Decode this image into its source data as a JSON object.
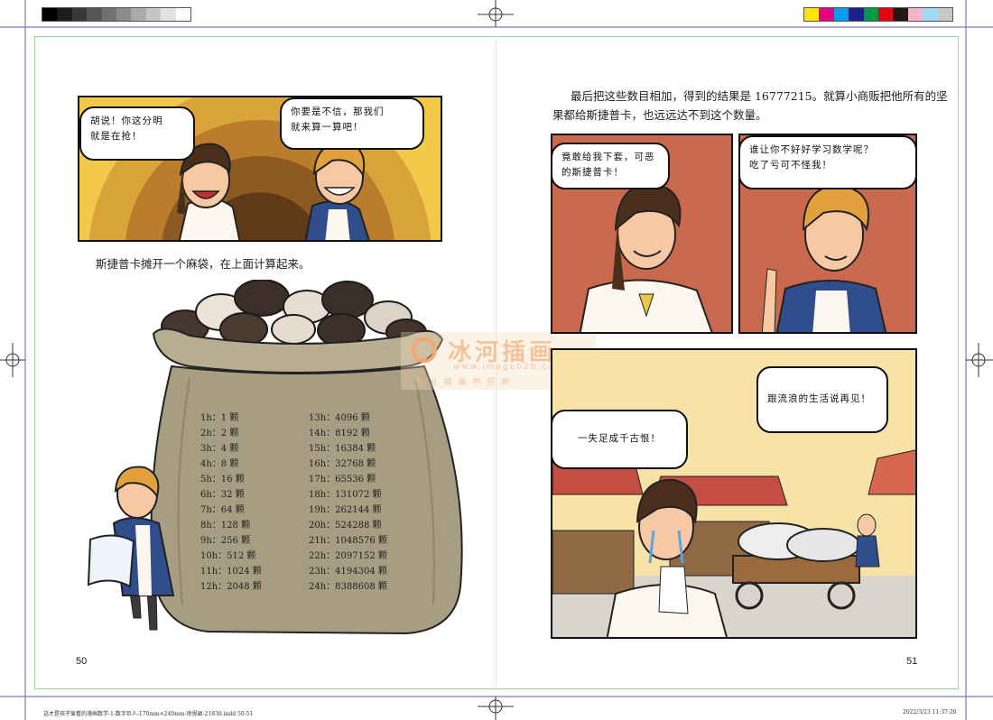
{
  "print_marks": {
    "grayscale_swatches": [
      "#000000",
      "#1c1c1c",
      "#383838",
      "#555555",
      "#717171",
      "#8d8d8d",
      "#aaaaaa",
      "#c6c6c6",
      "#e2e2e2",
      "#ffffff"
    ],
    "color_swatches": [
      "#ffe600",
      "#e4007f",
      "#00a0e9",
      "#1d2088",
      "#009944",
      "#e60012",
      "#231815",
      "#f5b2c8",
      "#9fd9f6",
      "#c9c9c9"
    ]
  },
  "left_page": {
    "panel_top": {
      "bubble_left": "胡说！你这分明\n就是在抢！",
      "bubble_right": "你要是不信，那我们\n就来算一算吧！"
    },
    "caption": "斯捷普卡摊开一个麻袋，在上面计算起来。",
    "sack_table": {
      "left_column": [
        {
          "hour": "1h：",
          "amount": "1 颗"
        },
        {
          "hour": "2h：",
          "amount": "2 颗"
        },
        {
          "hour": "3h：",
          "amount": "4 颗"
        },
        {
          "hour": "4h：",
          "amount": "8 颗"
        },
        {
          "hour": "5h：",
          "amount": "16 颗"
        },
        {
          "hour": "6h：",
          "amount": "32 颗"
        },
        {
          "hour": "7h：",
          "amount": "64 颗"
        },
        {
          "hour": "8h：",
          "amount": "128 颗"
        },
        {
          "hour": "9h：",
          "amount": "256 颗"
        },
        {
          "hour": "10h：",
          "amount": "512 颗"
        },
        {
          "hour": "11h：",
          "amount": "1024 颗"
        },
        {
          "hour": "12h：",
          "amount": "2048 颗"
        }
      ],
      "right_column": [
        {
          "hour": "13h：",
          "amount": "4096 颗"
        },
        {
          "hour": "14h：",
          "amount": "8192 颗"
        },
        {
          "hour": "15h：",
          "amount": "16384 颗"
        },
        {
          "hour": "16h：",
          "amount": "32768 颗"
        },
        {
          "hour": "17h：",
          "amount": "65536 颗"
        },
        {
          "hour": "18h：",
          "amount": "131072 颗"
        },
        {
          "hour": "19h：",
          "amount": "262144 颗"
        },
        {
          "hour": "20h：",
          "amount": "524288 颗"
        },
        {
          "hour": "21h：",
          "amount": "1048576 颗"
        },
        {
          "hour": "22h：",
          "amount": "2097152 颗"
        },
        {
          "hour": "23h：",
          "amount": "4194304 颗"
        },
        {
          "hour": "24h：",
          "amount": "8388608 颗"
        }
      ]
    },
    "page_number": "50"
  },
  "right_page": {
    "caption_line1": "最后把这些数目相加，得到的结果是 16777215。就算小商贩把他所有的坚",
    "caption_line2": "果都给斯捷普卡，也远远达不到这个数量。",
    "panel_a_bubble": "竟敢给我下套，可恶\n的斯捷普卡！",
    "panel_b_bubble": "谁让你不好好学习数学呢？\n吃了亏可不怪我！",
    "panel_c_bubble_right": "跟流浪的生活说再见！",
    "panel_c_bubble_left": "一失足成千古恨！",
    "page_number": "51"
  },
  "watermark": {
    "title": "冰河插画",
    "url": "www.imageb2b.com",
    "tagline": "专 业 插 画 供 应 商"
  },
  "footer": {
    "left": "这才是孩子爱看的漫画数学-1-数字巨人-170mm×240mm-徐恩颖-21830.indd 50-51",
    "right": "2022/3/23   11:37:26"
  }
}
